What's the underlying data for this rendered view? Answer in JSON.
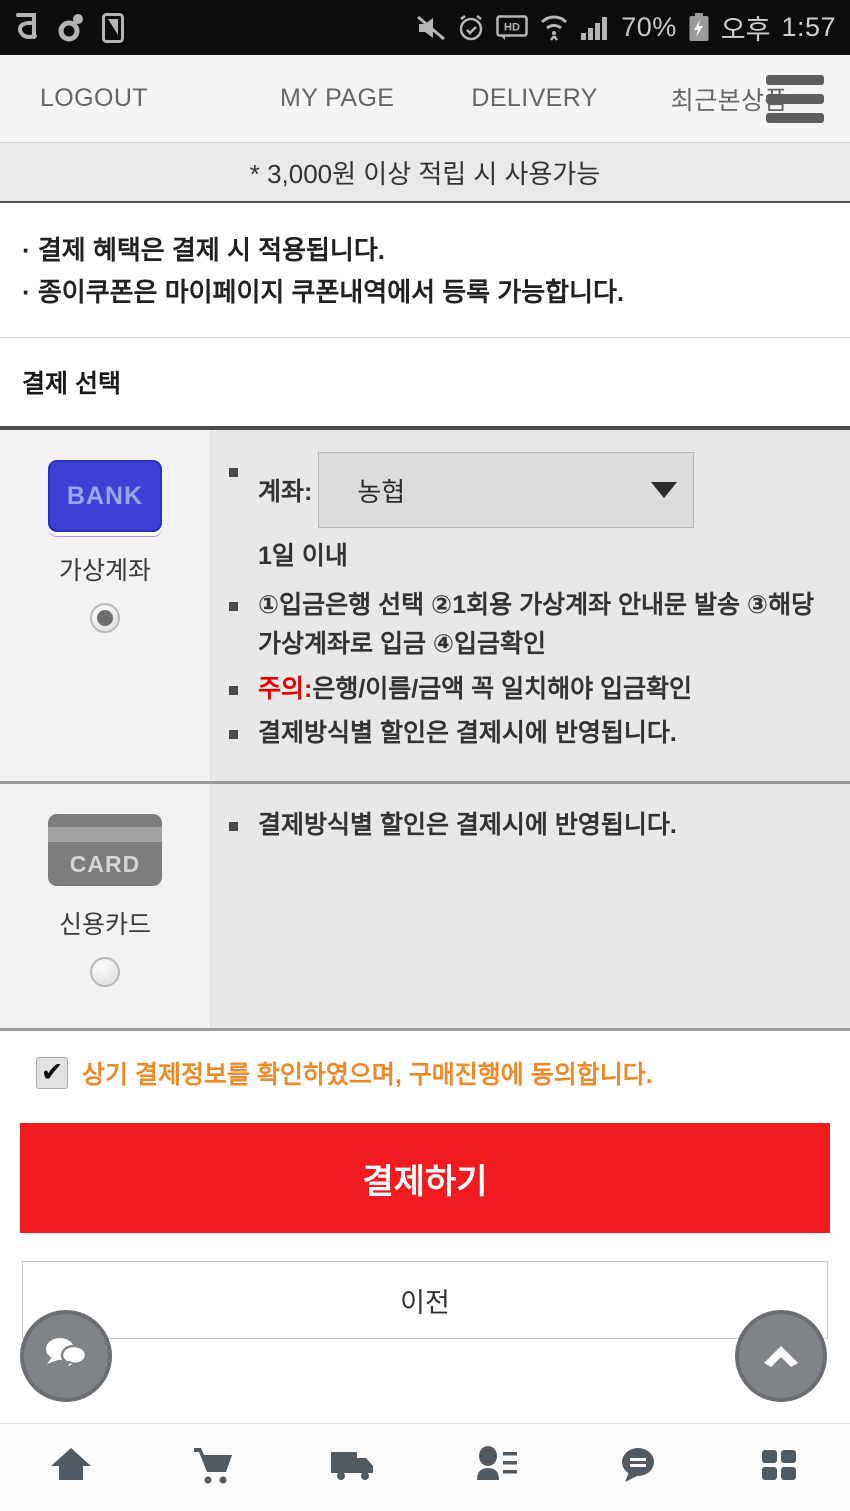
{
  "status_bar": {
    "left_icons": [
      "app-icon-u",
      "app-icon-dot",
      "app-icon-phone"
    ],
    "right_icons": [
      "mute-icon",
      "alarm-icon",
      "hd-icon",
      "wifi-icon",
      "signal-icon"
    ],
    "battery_percent": "70%",
    "battery_icon": "battery-charging-icon",
    "ampm": "오후",
    "time": "1:57"
  },
  "top_nav": {
    "items": [
      {
        "label": "LOGOUT",
        "name": "nav-logout"
      },
      {
        "label": "MY PAGE",
        "name": "nav-mypage"
      },
      {
        "label": "DELIVERY",
        "name": "nav-delivery"
      },
      {
        "label": "최근본상품",
        "name": "nav-recent"
      }
    ],
    "menu_icon": "hamburger-menu-icon"
  },
  "notice_bar": {
    "text": "* 3,000원 이상 적립 시 사용가능"
  },
  "info_notes": [
    "· 결제 혜택은 결제 시 적용됩니다.",
    "· 종이쿠폰은 마이페이지 쿠폰내역에서 등록 가능합니다."
  ],
  "section": {
    "title": "결제 선택"
  },
  "payment_methods": [
    {
      "id": "virtual-account",
      "icon_text": "BANK",
      "icon_name": "bank-icon",
      "label": "가상계좌",
      "selected": true,
      "account_label": "계좌:",
      "account_value": "농협",
      "account_caret": "dropdown-caret-icon",
      "sub_note": "1일 이내",
      "bullets": [
        {
          "text": "①입금은행 선택 ②1회용 가상계좌 안내문 발송 ③해당 가상계좌로 입금 ④입금확인",
          "warn_prefix": ""
        },
        {
          "text": "은행/이름/금액 꼭 일치해야 입금확인",
          "warn_prefix": "주의:"
        },
        {
          "text": "결제방식별 할인은 결제시에 반영됩니다.",
          "warn_prefix": ""
        }
      ]
    },
    {
      "id": "credit-card",
      "icon_text": "CARD",
      "icon_name": "card-icon",
      "label": "신용카드",
      "selected": false,
      "bullets": [
        {
          "text": "결제방식별 할인은 결제시에 반영됩니다.",
          "warn_prefix": ""
        }
      ]
    }
  ],
  "agreement": {
    "checked": true,
    "text": "상기 결제정보를 확인하였으며, 구매진행에 동의합니다.",
    "color": "#f08a28"
  },
  "actions": {
    "pay_label": "결제하기",
    "pay_color": "#f11a1f",
    "prev_label": "이전"
  },
  "floating_buttons": [
    {
      "name": "chat-fab",
      "icon": "chat-bubbles-icon"
    },
    {
      "name": "scroll-top-fab",
      "icon": "chevron-up-icon"
    }
  ],
  "bottom_nav": [
    {
      "name": "home-icon"
    },
    {
      "name": "cart-icon"
    },
    {
      "name": "delivery-truck-icon"
    },
    {
      "name": "profile-icon"
    },
    {
      "name": "chat-icon"
    },
    {
      "name": "grid-menu-icon"
    }
  ]
}
